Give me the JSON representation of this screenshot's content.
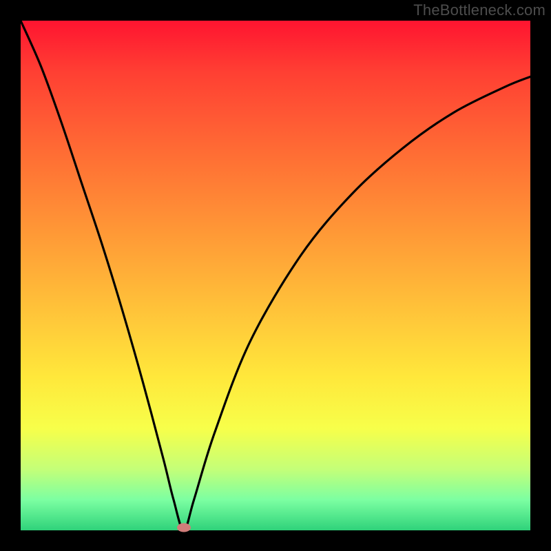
{
  "watermark": "TheBottleneck.com",
  "chart_data": {
    "type": "line",
    "title": "",
    "xlabel": "",
    "ylabel": "",
    "xlim": [
      0,
      1
    ],
    "ylim": [
      0,
      1
    ],
    "x_unit": "normalized",
    "y_unit": "bottleneck (green=low, red=high)",
    "min_x": 0.32,
    "curve": {
      "x": [
        0.0,
        0.04,
        0.08,
        0.12,
        0.16,
        0.2,
        0.24,
        0.28,
        0.3,
        0.32,
        0.34,
        0.38,
        0.45,
        0.55,
        0.65,
        0.75,
        0.85,
        0.95,
        1.0
      ],
      "y": [
        1.0,
        0.91,
        0.8,
        0.68,
        0.56,
        0.43,
        0.29,
        0.14,
        0.06,
        0.0,
        0.06,
        0.19,
        0.37,
        0.54,
        0.66,
        0.75,
        0.82,
        0.87,
        0.89
      ]
    },
    "marker": {
      "x": 0.32,
      "y": 0.0
    },
    "gradient_stops": [
      {
        "pos": 0.0,
        "color": "#ff1430"
      },
      {
        "pos": 0.1,
        "color": "#ff3f33"
      },
      {
        "pos": 0.25,
        "color": "#ff6a34"
      },
      {
        "pos": 0.4,
        "color": "#ff9436"
      },
      {
        "pos": 0.55,
        "color": "#ffbe39"
      },
      {
        "pos": 0.7,
        "color": "#ffe83b"
      },
      {
        "pos": 0.8,
        "color": "#f7ff4a"
      },
      {
        "pos": 0.88,
        "color": "#c4ff78"
      },
      {
        "pos": 0.94,
        "color": "#7cffa2"
      },
      {
        "pos": 1.0,
        "color": "#2fd27a"
      }
    ]
  }
}
